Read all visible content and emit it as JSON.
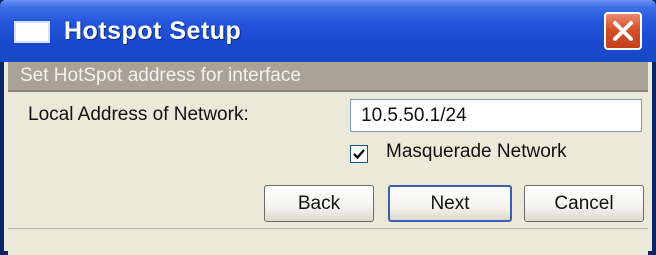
{
  "window": {
    "title": "Hotspot Setup"
  },
  "section": {
    "heading": "Set HotSpot address for interface"
  },
  "form": {
    "local_address_label": "Local Address of Network:",
    "local_address_value": "10.5.50.1/24",
    "masquerade_label": "Masquerade Network",
    "masquerade_checked": true
  },
  "buttons": {
    "back": "Back",
    "next": "Next",
    "cancel": "Cancel"
  },
  "icons": {
    "app": "window-icon",
    "close": "close-icon",
    "check": "checkmark-icon"
  },
  "colors": {
    "titlebar": "#2456dc",
    "close_button": "#d5502a",
    "section_header": "#a9a295",
    "dialog_background": "#ece9d8"
  }
}
